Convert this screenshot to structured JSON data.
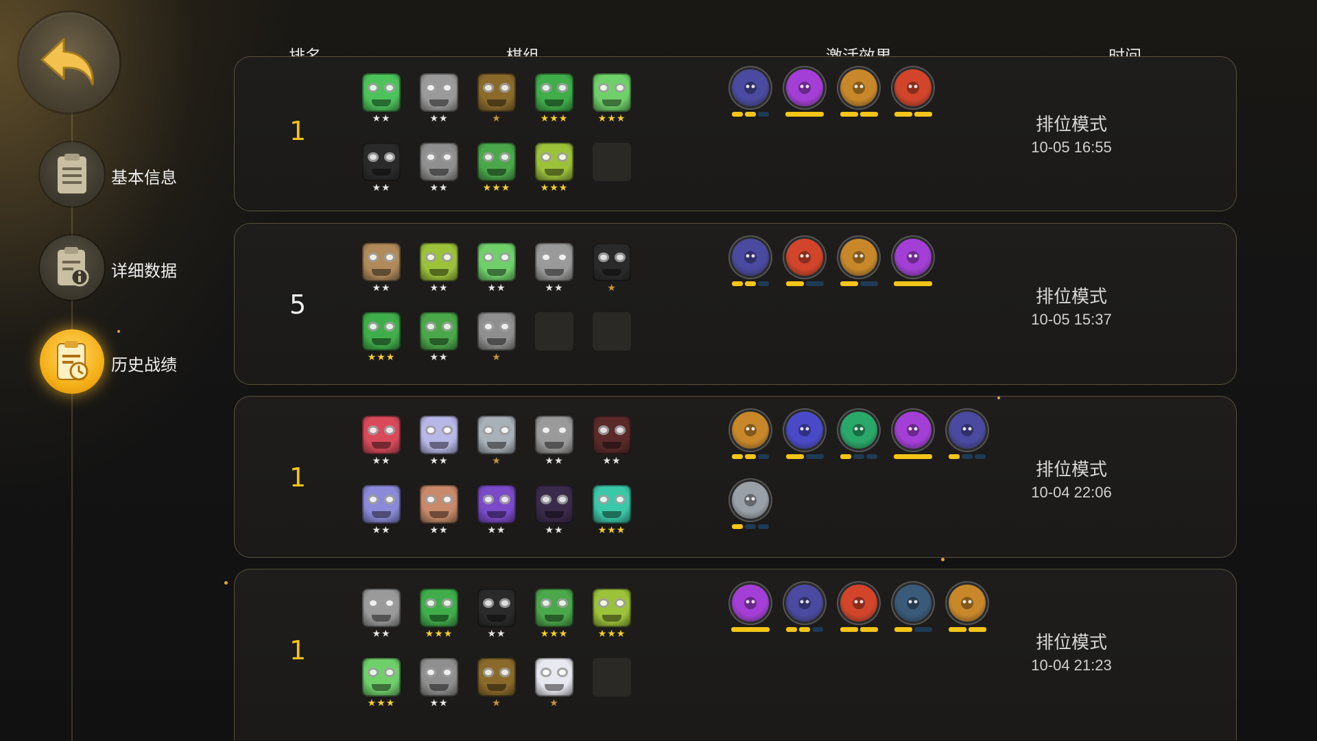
{
  "nav": {
    "items": [
      {
        "label": "基本信息",
        "icon": "document-list-icon",
        "active": false
      },
      {
        "label": "详细数据",
        "icon": "document-info-icon",
        "active": false
      },
      {
        "label": "历史战绩",
        "icon": "history-clock-icon",
        "active": true
      }
    ]
  },
  "columns": {
    "rank": "排名",
    "lineup": "棋组",
    "traits": "激活效果",
    "time": "时间"
  },
  "colors": {
    "accent_gold": "#f5c518",
    "bar_inactive": "#1e3a55",
    "star_bronze": "#c6953a",
    "star_silver": "#e6e6e6",
    "star_gold": "#f5d02a"
  },
  "matches": [
    {
      "rank": "1",
      "rank_color": "#f5c518",
      "mode": "排位模式",
      "time": "10-05 16:55",
      "units": [
        {
          "stars": 2,
          "color": "#4cc35a",
          "name": "goblin-orange-helmet"
        },
        {
          "stars": 2,
          "color": "#9a9a9a",
          "name": "grey-robot-red-eye"
        },
        {
          "stars": 1,
          "color": "#8a6a2a",
          "name": "fire-orc"
        },
        {
          "stars": 3,
          "color": "#3fae4a",
          "name": "green-red-scarf"
        },
        {
          "stars": 3,
          "color": "#6fd06a",
          "name": "green-blue-goggles"
        },
        {
          "stars": 2,
          "color": "#2a2a2a",
          "name": "black-hood"
        },
        {
          "stars": 2,
          "color": "#8f8f8f",
          "name": "grey-mech"
        },
        {
          "stars": 3,
          "color": "#4aa84a",
          "name": "green-gear-bot"
        },
        {
          "stars": 3,
          "color": "#9cc23a",
          "name": "yellow-goggles"
        },
        {
          "stars": 0,
          "color": "",
          "name": "empty"
        }
      ],
      "traits": [
        {
          "icon": "mech-screen-icon",
          "color": "#4a4aa0",
          "bars": [
            1,
            1,
            0
          ]
        },
        {
          "icon": "demon-purple-icon",
          "color": "#a33fd6",
          "bars": [
            1
          ]
        },
        {
          "icon": "gear-icon",
          "color": "#c8882a",
          "bars": [
            1,
            1
          ]
        },
        {
          "icon": "horned-red-icon",
          "color": "#d2452a",
          "bars": [
            1,
            1
          ]
        }
      ]
    },
    {
      "rank": "5",
      "rank_color": "#f0f0f0",
      "mode": "排位模式",
      "time": "10-05 15:37",
      "units": [
        {
          "stars": 2,
          "color": "#b08a5a",
          "name": "wood-mummy"
        },
        {
          "stars": 2,
          "color": "#9cc23a",
          "name": "yellow-goggles"
        },
        {
          "stars": 2,
          "color": "#6fd06a",
          "name": "green-blue-goggles"
        },
        {
          "stars": 2,
          "color": "#9a9a9a",
          "name": "grey-robot-red-eye"
        },
        {
          "stars": 1,
          "color": "#2a2a2a",
          "name": "black-hood"
        },
        {
          "stars": 3,
          "color": "#3fae4a",
          "name": "green-red-scarf"
        },
        {
          "stars": 2,
          "color": "#4aa84a",
          "name": "green-gear-bot"
        },
        {
          "stars": 1,
          "color": "#8f8f8f",
          "name": "grey-mech"
        },
        {
          "stars": 0,
          "color": "",
          "name": "empty"
        },
        {
          "stars": 0,
          "color": "",
          "name": "empty"
        }
      ],
      "traits": [
        {
          "icon": "mech-screen-icon",
          "color": "#4a4aa0",
          "bars": [
            1,
            1,
            0
          ]
        },
        {
          "icon": "horned-red-icon",
          "color": "#d2452a",
          "bars": [
            1,
            0
          ]
        },
        {
          "icon": "gear-icon",
          "color": "#c8882a",
          "bars": [
            1,
            0
          ]
        },
        {
          "icon": "demon-purple-icon",
          "color": "#a33fd6",
          "bars": [
            1
          ]
        }
      ]
    },
    {
      "rank": "1",
      "rank_color": "#f5c518",
      "mode": "排位模式",
      "time": "10-04 22:06",
      "units": [
        {
          "stars": 2,
          "color": "#d84a5a",
          "name": "red-pirate"
        },
        {
          "stars": 2,
          "color": "#b8b8e8",
          "name": "pale-blue-cap"
        },
        {
          "stars": 1,
          "color": "#a8b0b8",
          "name": "armored-knight"
        },
        {
          "stars": 2,
          "color": "#9a9a9a",
          "name": "grey-robot-red-eye"
        },
        {
          "stars": 2,
          "color": "#5a2a2a",
          "name": "red-hat-bearded"
        },
        {
          "stars": 2,
          "color": "#8a8ad8",
          "name": "purple-elephant"
        },
        {
          "stars": 2,
          "color": "#c88a6a",
          "name": "brown-shouting"
        },
        {
          "stars": 2,
          "color": "#7a4ac8",
          "name": "purple-hair-woman"
        },
        {
          "stars": 2,
          "color": "#3a2a4a",
          "name": "dark-winged-masked"
        },
        {
          "stars": 3,
          "color": "#3ac8a8",
          "name": "teal-haired-elf"
        }
      ],
      "traits": [
        {
          "icon": "axe-icon",
          "color": "#c8882a",
          "bars": [
            1,
            1,
            0
          ]
        },
        {
          "icon": "fishbone-icon",
          "color": "#4a4ac8",
          "bars": [
            1,
            0
          ]
        },
        {
          "icon": "paw-icon",
          "color": "#2aa86a",
          "bars": [
            1,
            0,
            0
          ]
        },
        {
          "icon": "demon-purple-icon",
          "color": "#a33fd6",
          "bars": [
            1
          ]
        },
        {
          "icon": "mech-screen-icon",
          "color": "#4a4aa0",
          "bars": [
            1,
            0,
            0
          ]
        },
        {
          "icon": "person-icon",
          "color": "#9aa0a8",
          "bars": [
            1,
            0,
            0
          ]
        }
      ]
    },
    {
      "rank": "1",
      "rank_color": "#f5c518",
      "mode": "排位模式",
      "time": "10-04 21:23",
      "units": [
        {
          "stars": 2,
          "color": "#9a9a9a",
          "name": "grey-robot-red-eye"
        },
        {
          "stars": 3,
          "color": "#3fae4a",
          "name": "green-red-scarf"
        },
        {
          "stars": 2,
          "color": "#2a2a2a",
          "name": "black-hood"
        },
        {
          "stars": 3,
          "color": "#4aa84a",
          "name": "green-gear-bot"
        },
        {
          "stars": 3,
          "color": "#9cc23a",
          "name": "yellow-goggles"
        },
        {
          "stars": 3,
          "color": "#6fd06a",
          "name": "green-blue-goggles"
        },
        {
          "stars": 2,
          "color": "#8f8f8f",
          "name": "grey-mech"
        },
        {
          "stars": 1,
          "color": "#8a6a2a",
          "name": "fire-orc"
        },
        {
          "stars": 1,
          "color": "#e8e8f0",
          "name": "white-hooded-mage"
        },
        {
          "stars": 0,
          "color": "",
          "name": "empty"
        }
      ],
      "traits": [
        {
          "icon": "demon-purple-icon",
          "color": "#a33fd6",
          "bars": [
            1
          ]
        },
        {
          "icon": "mech-screen-icon",
          "color": "#4a4aa0",
          "bars": [
            1,
            1,
            0
          ]
        },
        {
          "icon": "horned-red-icon",
          "color": "#d2452a",
          "bars": [
            1,
            1
          ]
        },
        {
          "icon": "swirl-icon",
          "color": "#3a5a7a",
          "bars": [
            1,
            0
          ]
        },
        {
          "icon": "gear-icon",
          "color": "#c8882a",
          "bars": [
            1,
            1
          ]
        }
      ]
    }
  ]
}
